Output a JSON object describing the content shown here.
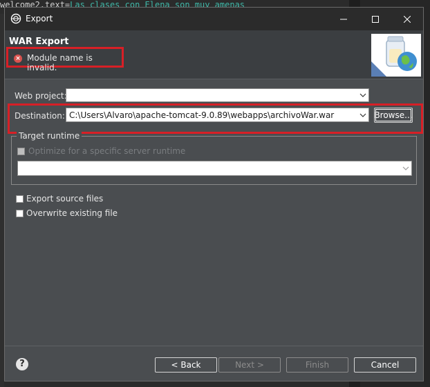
{
  "background_editor": {
    "code_key": "welcome2.text=",
    "code_value": "Las clases con Elena son muy amenas"
  },
  "window": {
    "title": "Export"
  },
  "header": {
    "title": "WAR Export",
    "error_message": "Module name is invalid."
  },
  "form": {
    "web_project_label": "Web project:",
    "web_project_value": "",
    "destination_label": "Destination:",
    "destination_value": "C:\\Users\\Alvaro\\apache-tomcat-9.0.89\\webapps\\archivoWar.war",
    "browse_label": "Browse...",
    "target_runtime_label": "Target runtime",
    "optimize_label": "Optimize for a specific server runtime",
    "optimize_checked": false,
    "runtime_value": "",
    "export_source_label": "Export source files",
    "export_source_checked": false,
    "overwrite_label": "Overwrite existing file",
    "overwrite_checked": false
  },
  "footer": {
    "help_glyph": "?",
    "back_label": "< Back",
    "next_label": "Next >",
    "finish_label": "Finish",
    "cancel_label": "Cancel"
  },
  "colors": {
    "error_highlight": "#d81f26",
    "dialog_bg": "#4a4d50",
    "titlebar_bg": "#2b2b2b"
  }
}
